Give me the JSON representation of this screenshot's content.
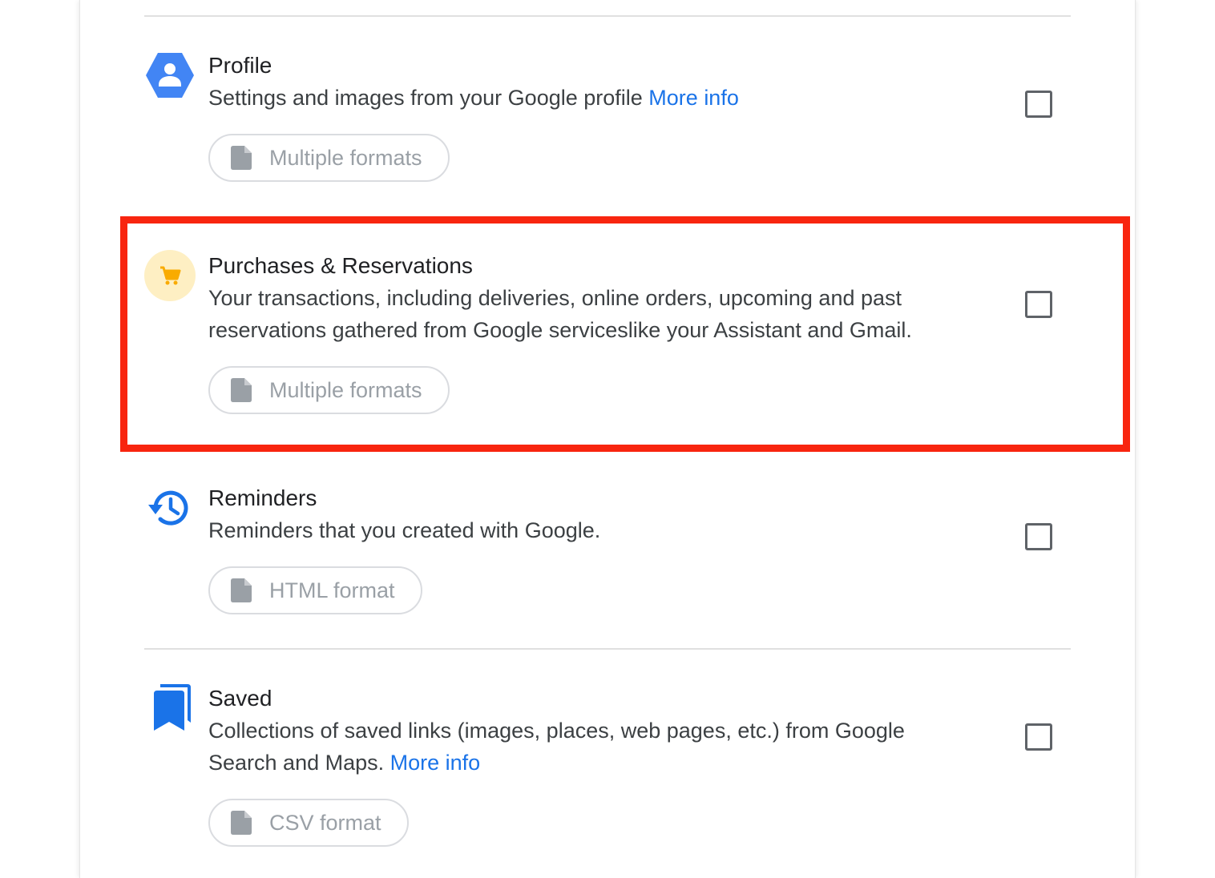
{
  "items": [
    {
      "title": "Profile",
      "desc": "Settings and images from your Google profile",
      "link": "More info",
      "format": "Multiple formats",
      "icon": "profile-hexagon-icon",
      "icon_color": "#4285f4"
    },
    {
      "title": "Purchases & Reservations",
      "desc": "Your transactions, including deliveries, online orders, upcoming and past reservations gathered from Google serviceslike your Assistant and Gmail.",
      "format": "Multiple formats",
      "icon": "shopping-cart-icon",
      "icon_color": "#f9ab00",
      "icon_bg": "#feefc3"
    },
    {
      "title": "Reminders",
      "desc": "Reminders that you created with Google.",
      "format": "HTML format",
      "icon": "history-clock-icon",
      "icon_color": "#1a73e8"
    },
    {
      "title": "Saved",
      "desc": "Collections of saved links (images, places, web pages, etc.) from Google Search and Maps.",
      "link": "More info",
      "format": "CSV format",
      "icon": "bookmarks-icon",
      "icon_color": "#1a73e8"
    }
  ],
  "colors": {
    "highlight": "#f8250f",
    "link": "#1a73e8",
    "chip_text": "#9aa0a6",
    "checkbox_border": "#5f6368"
  }
}
